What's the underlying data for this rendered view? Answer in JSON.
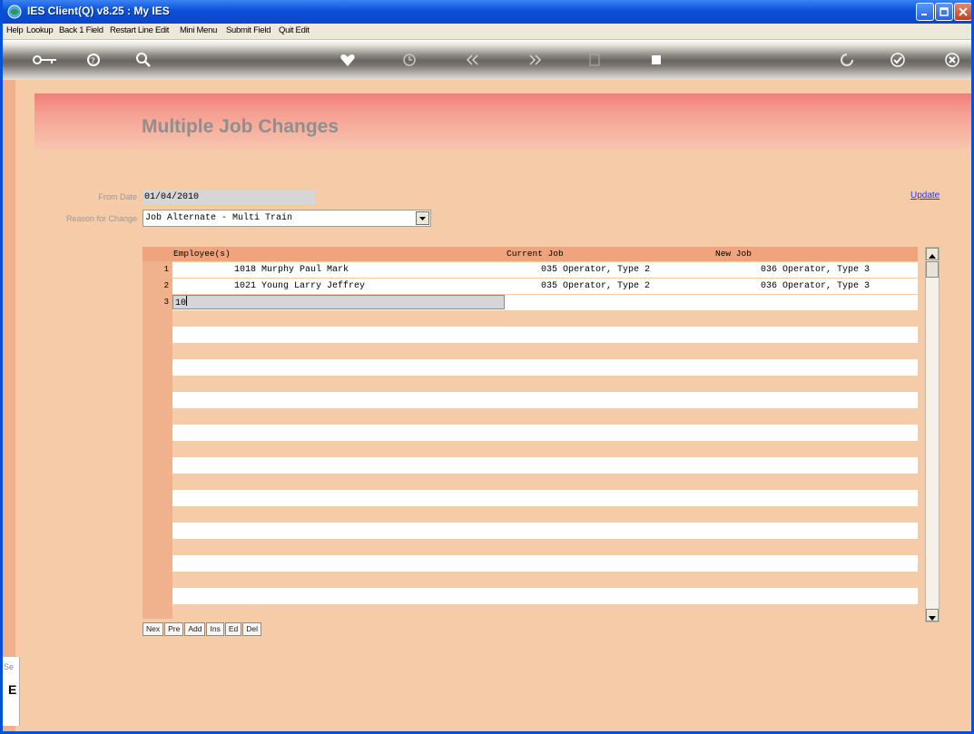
{
  "window": {
    "title": "IES Client(Q) v8.25 : My IES"
  },
  "menu": [
    "Help",
    "Lookup",
    "Back 1 Field",
    "Restart Line Edit",
    "Mini Menu",
    "Submit Field",
    "Quit Edit"
  ],
  "toolbar_icons": [
    "key-icon",
    "help-icon",
    "search-icon",
    "heart-icon",
    "clock-icon",
    "rewind-icon",
    "fast-forward-icon",
    "save-icon",
    "stop-icon",
    "refresh-icon",
    "check-icon",
    "close-icon"
  ],
  "page": {
    "title": "Multiple Job Changes"
  },
  "form": {
    "from_date_label": "From Date",
    "from_date_value": "01/04/2010",
    "reason_label": "Reason for Change",
    "reason_value": "Job Alternate - Multi Train",
    "update_link": "Update"
  },
  "grid": {
    "columns": [
      "Employee(s)",
      "Current Job",
      "New Job"
    ],
    "rows": [
      {
        "num": "1",
        "employee": "1018 Murphy Paul Mark",
        "current_job": "035 Operator, Type 2",
        "new_job": "036 Operator, Type 3"
      },
      {
        "num": "2",
        "employee": "1021 Young Larry Jeffrey",
        "current_job": "035 Operator, Type 2",
        "new_job": "036 Operator, Type 3"
      }
    ],
    "edit_row_num": "3",
    "edit_value": "10"
  },
  "nav_buttons": [
    "Nex",
    "Pre",
    "Add",
    "Ins",
    "Ed",
    "Del"
  ],
  "left_panel": {
    "line1": "Se",
    "line2": "E"
  },
  "colors": {
    "background": "#f6cba8",
    "header_band": "#f27d7b",
    "link": "#1f3dff",
    "titlebar": "#0c50d9"
  }
}
